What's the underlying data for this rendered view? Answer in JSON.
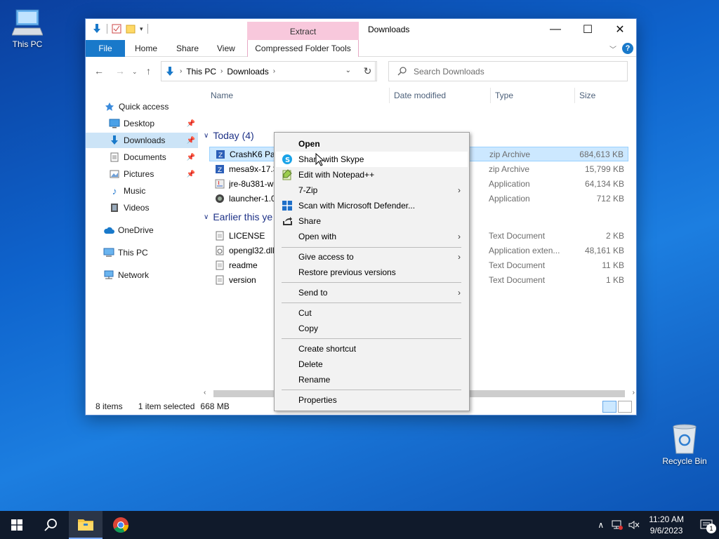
{
  "desktop": {
    "this_pc_label": "This PC",
    "recycle_bin_label": "Recycle Bin"
  },
  "window": {
    "title": "Downloads",
    "contextual_group": "Extract",
    "tabs": [
      "File",
      "Home",
      "Share",
      "View"
    ],
    "contextual_tab": "Compressed Folder Tools",
    "help": "?"
  },
  "address": {
    "crumbs": [
      "This PC",
      "Downloads"
    ],
    "search_placeholder": "Search Downloads"
  },
  "navpane": {
    "items": [
      {
        "label": "Quick access",
        "icon": "star-icon"
      },
      {
        "label": "Desktop",
        "icon": "desktop-icon",
        "pinned": true
      },
      {
        "label": "Downloads",
        "icon": "download-arrow-icon",
        "pinned": true,
        "selected": true
      },
      {
        "label": "Documents",
        "icon": "documents-icon",
        "pinned": true
      },
      {
        "label": "Pictures",
        "icon": "pictures-icon",
        "pinned": true
      },
      {
        "label": "Music",
        "icon": "music-icon"
      },
      {
        "label": "Videos",
        "icon": "videos-icon"
      },
      {
        "label": "OneDrive",
        "icon": "cloud-icon"
      },
      {
        "label": "This PC",
        "icon": "computer-icon"
      },
      {
        "label": "Network",
        "icon": "network-icon"
      }
    ]
  },
  "columns": [
    "Name",
    "Date modified",
    "Type",
    "Size"
  ],
  "groups": [
    {
      "label": "Today (4)",
      "files": [
        {
          "name": "CrashK6 Pack",
          "type": "zip Archive",
          "size": "684,613 KB",
          "selected": true
        },
        {
          "name": "mesa9x-17.3.",
          "type": "zip Archive",
          "size": "15,799 KB"
        },
        {
          "name": "jre-8u381-win",
          "type": "Application",
          "size": "64,134 KB"
        },
        {
          "name": "launcher-1.09",
          "type": "Application",
          "size": "712 KB"
        }
      ]
    },
    {
      "label": "Earlier this ye",
      "files": [
        {
          "name": "LICENSE",
          "type": "Text Document",
          "size": "2 KB"
        },
        {
          "name": "opengl32.dll",
          "type": "Application exten...",
          "size": "48,161 KB"
        },
        {
          "name": "readme",
          "type": "Text Document",
          "size": "11 KB"
        },
        {
          "name": "version",
          "type": "Text Document",
          "size": "1 KB"
        }
      ]
    }
  ],
  "status": {
    "items": "8 items",
    "selected": "1 item selected",
    "size": "668 MB"
  },
  "context_menu": {
    "items": [
      {
        "label": "Open",
        "bold": true
      },
      {
        "label": "Share with Skype",
        "icon": "skype-icon",
        "hover": true
      },
      {
        "label": "Edit with Notepad++",
        "icon": "notepadpp-icon"
      },
      {
        "label": "7-Zip",
        "submenu": true
      },
      {
        "label": "Scan with Microsoft Defender...",
        "icon": "defender-icon"
      },
      {
        "label": "Share",
        "icon": "share-icon"
      },
      {
        "label": "Open with",
        "submenu": true
      },
      {
        "label": "Give access to",
        "submenu": true
      },
      {
        "label": "Restore previous versions"
      },
      {
        "label": "Send to",
        "submenu": true
      },
      {
        "label": "Cut"
      },
      {
        "label": "Copy"
      },
      {
        "label": "Create shortcut"
      },
      {
        "label": "Delete"
      },
      {
        "label": "Rename"
      },
      {
        "label": "Properties"
      }
    ]
  },
  "taskbar": {
    "time": "11:20 AM",
    "date": "9/6/2023",
    "notification_count": "1"
  }
}
